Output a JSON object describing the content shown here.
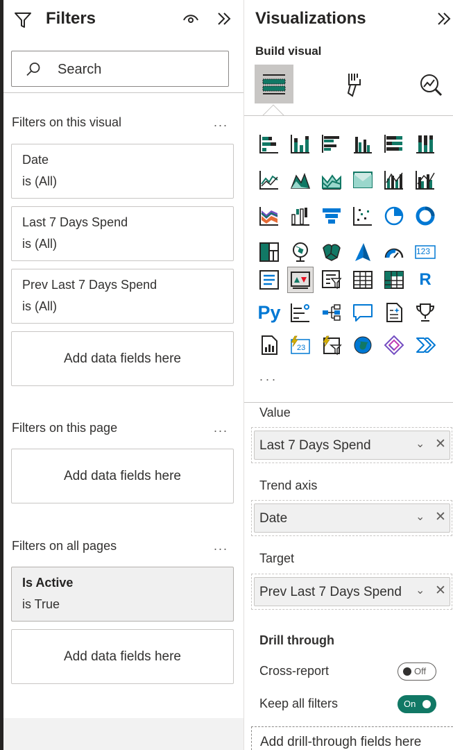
{
  "filters": {
    "title": "Filters",
    "search_placeholder": "Search",
    "sections": {
      "visual": {
        "label": "Filters on this visual",
        "more": "...",
        "cards": [
          {
            "title": "Date",
            "sub": "is (All)"
          },
          {
            "title": "Last 7 Days Spend",
            "sub": "is (All)"
          },
          {
            "title": "Prev Last 7 Days Spend",
            "sub": "is (All)"
          }
        ],
        "dropzone": "Add data fields here"
      },
      "page": {
        "label": "Filters on this page",
        "more": "...",
        "dropzone": "Add data fields here"
      },
      "all_pages": {
        "label": "Filters on all pages",
        "more": "...",
        "cards": [
          {
            "title": "Is Active",
            "sub": "is True"
          }
        ],
        "dropzone": "Add data fields here"
      }
    }
  },
  "visualizations": {
    "title": "Visualizations",
    "subtitle": "Build visual",
    "more": "...",
    "icon_text": {
      "r_visual": "R",
      "python_visual": "Py",
      "card_number": "123"
    },
    "wells": {
      "value": {
        "label": "Value",
        "field": "Last 7 Days Spend"
      },
      "trend_axis": {
        "label": "Trend axis",
        "field": "Date"
      },
      "target": {
        "label": "Target",
        "field": "Prev Last 7 Days Spend"
      }
    },
    "drill_through": {
      "title": "Drill through",
      "cross_report": {
        "label": "Cross-report",
        "state": "Off"
      },
      "keep_filters": {
        "label": "Keep all filters",
        "state": "On"
      },
      "dropzone": "Add drill-through fields here"
    }
  },
  "colors": {
    "accent_blue": "#0078d4",
    "toggle_on": "#117865",
    "chart_teal": "#117865",
    "chart_orange": "#e66c37",
    "chart_purple": "#744ec2",
    "chart_yellow": "#d9b300"
  }
}
